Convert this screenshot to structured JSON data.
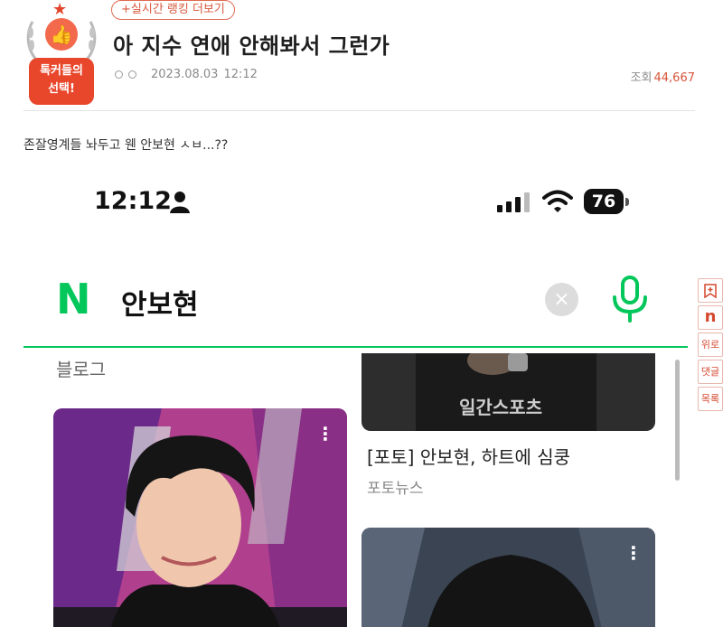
{
  "post": {
    "badge_line1": "톡커들의",
    "badge_line2": "선택!",
    "rank_link": "+실시간 랭킹 더보기",
    "title": "아 지수 연애 안해봐서 그런가",
    "date": "2023.08.03",
    "time": "12:12",
    "views_label": "조회",
    "views_count": "44,667",
    "body": "존잘영계들 놔두고 웬 안보현 ㅅㅂ...??"
  },
  "screenshot": {
    "status": {
      "time": "12:12",
      "battery": "76"
    },
    "search": {
      "logo": "N",
      "query": "안보현",
      "clear_icon": "×"
    },
    "results": {
      "blog_label": "블로그",
      "watermark": "일간스포츠",
      "news_caption": "[포토] 안보현, 하트에 심쿵",
      "news_source": "포토뉴스"
    }
  },
  "side_toolbar": {
    "items": [
      "",
      "n",
      "위로",
      "댓글",
      "목록"
    ]
  },
  "icons": {
    "badge": "thumbs-up-icon",
    "person": "person-icon",
    "signal": "signal-icon",
    "wifi": "wifi-icon",
    "mic": "microphone-icon",
    "bookmark": "bookmark-icon"
  },
  "colors": {
    "accent": "#e2452d",
    "naver_green": "#03c75a"
  }
}
